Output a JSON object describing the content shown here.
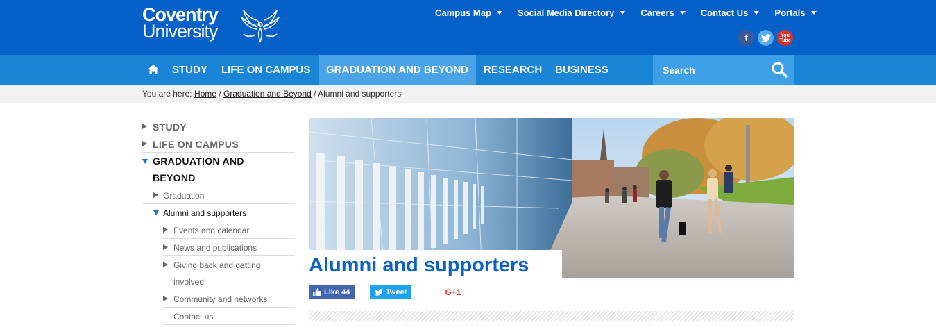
{
  "brand": {
    "line1": "Coventry",
    "line2": "University",
    "icon": "phoenix-logo-icon"
  },
  "topnav": {
    "items": [
      {
        "label": "Campus Map"
      },
      {
        "label": "Social Media Directory"
      },
      {
        "label": "Careers"
      },
      {
        "label": "Contact Us"
      },
      {
        "label": "Portals"
      }
    ],
    "social": [
      {
        "icon": "facebook-icon",
        "glyph": "f",
        "color": "#3b5998"
      },
      {
        "icon": "twitter-icon",
        "glyph": "t",
        "color": "#55acee"
      },
      {
        "icon": "youtube-icon",
        "glyph": "You Tube",
        "color": "#d3312b"
      }
    ]
  },
  "mainnav": {
    "home_icon": "home-icon",
    "items": [
      {
        "label": "STUDY"
      },
      {
        "label": "LIFE ON CAMPUS"
      },
      {
        "label": "GRADUATION AND BEYOND",
        "active": true
      },
      {
        "label": "RESEARCH"
      },
      {
        "label": "BUSINESS"
      }
    ],
    "search_placeholder": "Search"
  },
  "breadcrumb": {
    "prefix": "You are here:",
    "links": [
      "Home",
      "Graduation and Beyond"
    ],
    "current": "Alumni and supporters",
    "separator": "/"
  },
  "sidebar": {
    "level1": [
      {
        "label": "STUDY"
      },
      {
        "label": "LIFE ON CAMPUS"
      },
      {
        "label_line1": "GRADUATION AND",
        "label_line2": "BEYOND",
        "expanded": true
      }
    ],
    "level2": [
      {
        "label": "Graduation"
      },
      {
        "label": "Alumni and supporters",
        "expanded": true
      }
    ],
    "level3": [
      {
        "label": "Events and calendar"
      },
      {
        "label": "News and publications"
      },
      {
        "label_line1": "Giving back and getting",
        "label_line2": "involved"
      },
      {
        "label": "Community and networks"
      },
      {
        "label": "Contact us"
      }
    ]
  },
  "page": {
    "title": "Alumni and supporters"
  },
  "share": {
    "like_label": "Like",
    "like_count": "44",
    "tweet_label": "Tweet",
    "gplus_label": "G+1"
  },
  "colors": {
    "header": "#0561c8",
    "nav": "#1a85d6",
    "nav_active": "#4aa3e6",
    "title": "#0b63c4"
  }
}
